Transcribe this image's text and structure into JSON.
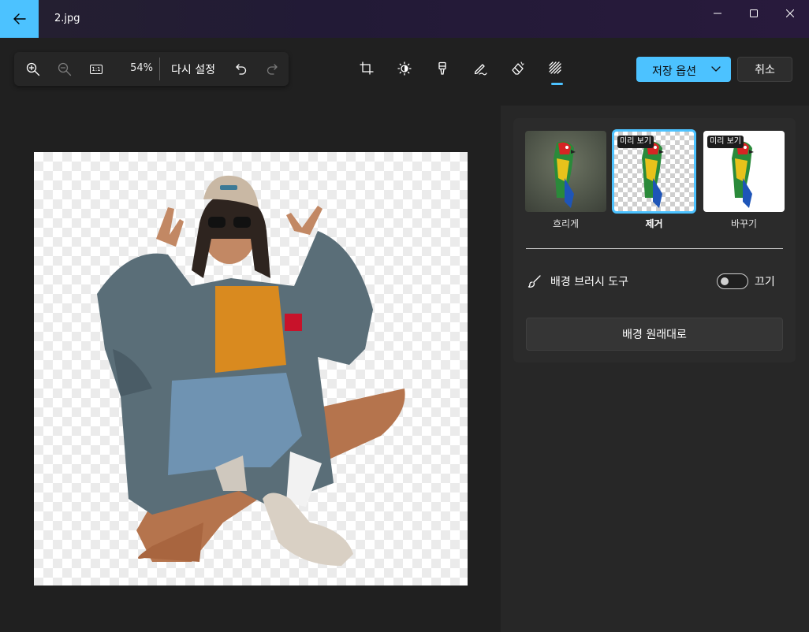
{
  "window": {
    "filename": "2.jpg",
    "back_icon": "arrow-left-icon",
    "controls": [
      "minimize-icon",
      "maximize-icon",
      "close-icon"
    ]
  },
  "zoom_toolbar": {
    "zoom_in_icon": "zoom-in-icon",
    "zoom_out_icon": "zoom-out-icon",
    "actual_size_icon": "actual-size-icon",
    "actual_size_text": "1:1",
    "zoom_percent": "54%",
    "reset_label": "다시 설정",
    "undo_icon": "undo-icon",
    "redo_icon": "redo-icon"
  },
  "edit_tools": [
    {
      "name": "crop-icon",
      "active": false
    },
    {
      "name": "adjust-brightness-icon",
      "active": false
    },
    {
      "name": "filter-icon",
      "active": false
    },
    {
      "name": "markup-pen-icon",
      "active": false
    },
    {
      "name": "erase-icon",
      "active": false
    },
    {
      "name": "background-icon",
      "active": true
    }
  ],
  "actions": {
    "save_label": "저장 옵션",
    "cancel_label": "취소"
  },
  "colors": {
    "accent": "#4cc2ff",
    "background": "#202020",
    "panel": "#272727"
  },
  "background_panel": {
    "options": [
      {
        "label": "흐리게",
        "preview_badge": "",
        "selected": false
      },
      {
        "label": "제거",
        "preview_badge": "미리 보기",
        "selected": true
      },
      {
        "label": "바꾸기",
        "preview_badge": "미리 보기",
        "selected": false
      }
    ],
    "brush_tool_label": "배경 브러시 도구",
    "brush_toggle_state": "끄기",
    "restore_label": "배경 원래대로"
  }
}
